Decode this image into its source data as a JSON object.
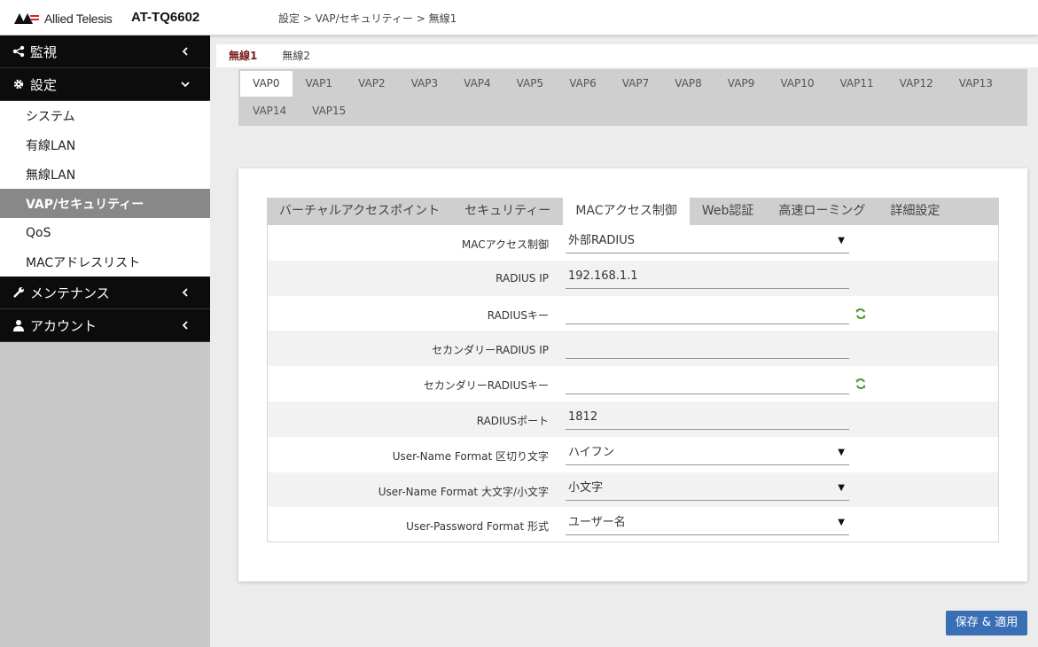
{
  "header": {
    "brand": "Allied Telesis",
    "model": "AT-TQ6602",
    "breadcrumb": "設定 > VAP/セキュリティー > 無線1"
  },
  "sidebar": {
    "sections": [
      {
        "label": "監視",
        "icon": "share-icon"
      },
      {
        "label": "設定",
        "icon": "gear-icon"
      },
      {
        "label": "メンテナンス",
        "icon": "wrench-icon"
      },
      {
        "label": "アカウント",
        "icon": "user-icon"
      }
    ],
    "settings_items": [
      "システム",
      "有線LAN",
      "無線LAN",
      "VAP/セキュリティー",
      "QoS",
      "MACアドレスリスト"
    ],
    "active_item": "VAP/セキュリティー"
  },
  "radio_tabs": [
    "無線1",
    "無線2"
  ],
  "vap_tabs": [
    "VAP0",
    "VAP1",
    "VAP2",
    "VAP3",
    "VAP4",
    "VAP5",
    "VAP6",
    "VAP7",
    "VAP8",
    "VAP9",
    "VAP10",
    "VAP11",
    "VAP12",
    "VAP13",
    "VAP14",
    "VAP15"
  ],
  "inner_tabs": [
    "バーチャルアクセスポイント",
    "セキュリティー",
    "MACアクセス制御",
    "Web認証",
    "高速ローミング",
    "詳細設定"
  ],
  "form": {
    "rows": [
      {
        "label": "MACアクセス制御",
        "value": "外部RADIUS",
        "type": "select"
      },
      {
        "label": "RADIUS IP",
        "value": "192.168.1.1",
        "type": "input"
      },
      {
        "label": "RADIUSキー",
        "value": "",
        "type": "password"
      },
      {
        "label": "セカンダリーRADIUS IP",
        "value": "",
        "type": "input"
      },
      {
        "label": "セカンダリーRADIUSキー",
        "value": "",
        "type": "password"
      },
      {
        "label": "RADIUSポート",
        "value": "1812",
        "type": "input"
      },
      {
        "label": "User-Name Format 区切り文字",
        "value": "ハイフン",
        "type": "select"
      },
      {
        "label": "User-Name Format 大文字/小文字",
        "value": "小文字",
        "type": "select"
      },
      {
        "label": "User-Password Format 形式",
        "value": "ユーザー名",
        "type": "select"
      }
    ]
  },
  "buttons": {
    "save_apply": "保存 & 適用"
  },
  "colors": {
    "accent_blue": "#3a6fb5",
    "active_radio_tab": "#7a1b1b",
    "sidebar_dark": "#0c0c0c",
    "refresh_green": "#4a9a2a"
  }
}
